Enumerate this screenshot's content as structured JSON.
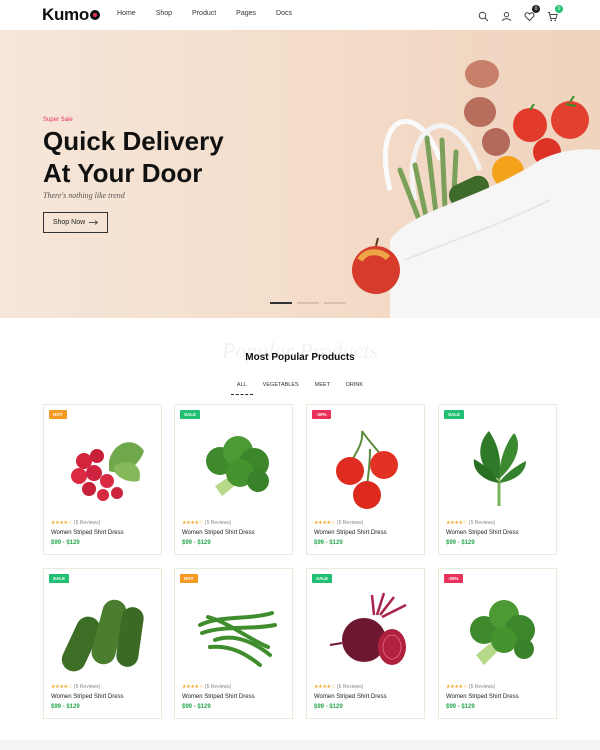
{
  "nav": {
    "logo": "Kumo",
    "menu": [
      "Home",
      "Shop",
      "Product",
      "Pages",
      "Docs"
    ],
    "icons": [
      "search-icon",
      "user-icon",
      "wishlist-icon",
      "cart-icon"
    ],
    "wishlist_count": "0",
    "cart_count": "0"
  },
  "hero": {
    "super_sale": "Super Sale",
    "title_line1": "Quick Delivery",
    "title_line2": "At Your Door",
    "tagline": "There's nothing like trend",
    "button": "Shop Now",
    "slides": 3,
    "active_slide": 1
  },
  "section": {
    "ghost_text": "Popular Products",
    "title": "Most Popular Products",
    "tabs": [
      "ALL",
      "VEGETABLES",
      "MEET",
      "DRINK"
    ],
    "active_tab": "ALL"
  },
  "products": [
    {
      "tag": "HOT",
      "tag_color": "#f59a23",
      "image": "radish-icon",
      "rating": 4,
      "reviews": "(5 Reviews)",
      "name": "Women Striped Shirt Dress",
      "price": "$99 - $129"
    },
    {
      "tag": "SALE",
      "tag_color": "#21bf73",
      "image": "broccoli-icon",
      "rating": 4,
      "reviews": "(5 Reviews)",
      "name": "Women Striped Shirt Dress",
      "price": "$99 - $129"
    },
    {
      "tag": "-30%",
      "tag_color": "#e8315b",
      "image": "tomato-icon",
      "rating": 4,
      "reviews": "(5 Reviews)",
      "name": "Women Striped Shirt Dress",
      "price": "$99 - $129"
    },
    {
      "tag": "SALE",
      "tag_color": "#21bf73",
      "image": "spinach-icon",
      "rating": 4,
      "reviews": "(5 Reviews)",
      "name": "Women Striped Shirt Dress",
      "price": "$99 - $129"
    },
    {
      "tag": "SALE",
      "tag_color": "#21bf73",
      "image": "cucumber-icon",
      "rating": 4,
      "reviews": "(5 Reviews)",
      "name": "Women Striped Shirt Dress",
      "price": "$99 - $129"
    },
    {
      "tag": "HOT",
      "tag_color": "#f59a23",
      "image": "green-beans-icon",
      "rating": 4,
      "reviews": "(5 Reviews)",
      "name": "Women Striped Shirt Dress",
      "price": "$99 - $129"
    },
    {
      "tag": "SALE",
      "tag_color": "#21bf73",
      "image": "beetroot-icon",
      "rating": 4,
      "reviews": "(5 Reviews)",
      "name": "Women Striped Shirt Dress",
      "price": "$99 - $129"
    },
    {
      "tag": "-25%",
      "tag_color": "#e8315b",
      "image": "broccoli-icon",
      "rating": 4,
      "reviews": "(5 Reviews)",
      "name": "Women Striped Shirt Dress",
      "price": "$99 - $129"
    }
  ],
  "colors": {
    "accent": "#e8315b",
    "price": "#2aa84f",
    "star": "#f0a51a",
    "hero_bg": "#f3dcc9"
  }
}
